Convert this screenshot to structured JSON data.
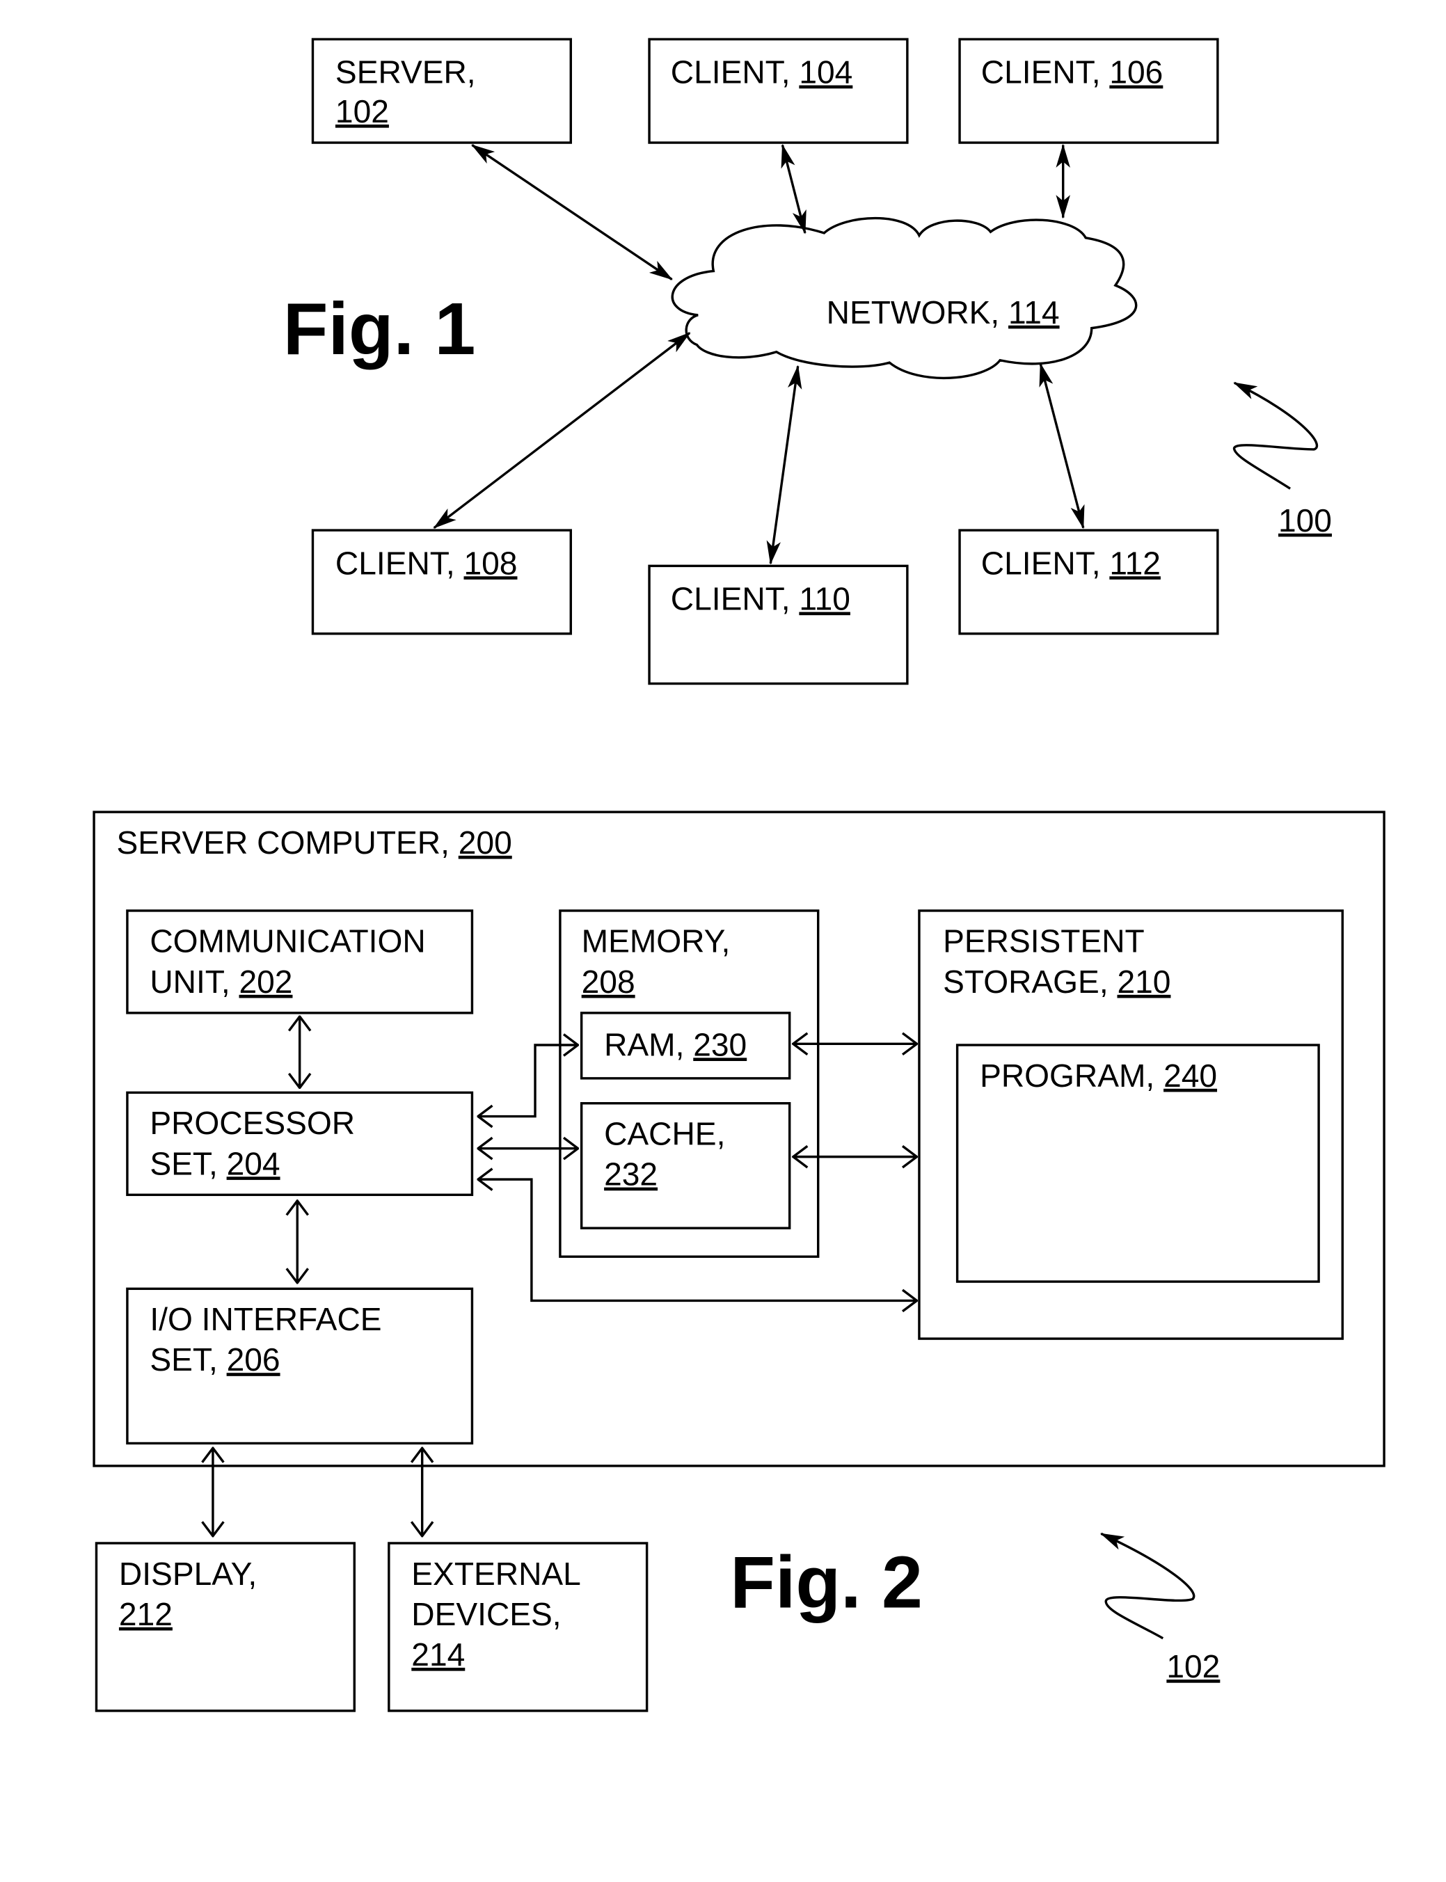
{
  "fig1": {
    "title": "Fig. 1",
    "reference": "100",
    "server": {
      "label": "SERVER,",
      "ref": "102"
    },
    "network": {
      "label": "NETWORK,",
      "ref": "114"
    },
    "clients": [
      {
        "label": "CLIENT,",
        "ref": "104"
      },
      {
        "label": "CLIENT,",
        "ref": "106"
      },
      {
        "label": "CLIENT,",
        "ref": "108"
      },
      {
        "label": "CLIENT,",
        "ref": "110"
      },
      {
        "label": "CLIENT,",
        "ref": "112"
      }
    ]
  },
  "fig2": {
    "title": "Fig. 2",
    "reference": "102",
    "server_computer": {
      "label": "SERVER COMPUTER,",
      "ref": "200"
    },
    "communication_unit": {
      "line1": "COMMUNICATION",
      "line2": "UNIT,",
      "ref": "202"
    },
    "processor_set": {
      "line1": "PROCESSOR",
      "line2": "SET,",
      "ref": "204"
    },
    "io_interface_set": {
      "line1": "I/O INTERFACE",
      "line2": "SET,",
      "ref": "206"
    },
    "memory": {
      "line1": "MEMORY,",
      "ref": "208"
    },
    "ram": {
      "label": "RAM,",
      "ref": "230"
    },
    "cache": {
      "line1": "CACHE,",
      "ref": "232"
    },
    "persistent_storage": {
      "line1": "PERSISTENT",
      "line2": "STORAGE,",
      "ref": "210"
    },
    "program": {
      "label": "PROGRAM,",
      "ref": "240"
    },
    "display": {
      "line1": "DISPLAY,",
      "ref": "212"
    },
    "external_devices": {
      "line1": "EXTERNAL",
      "line2": "DEVICES,",
      "ref": "214"
    }
  }
}
